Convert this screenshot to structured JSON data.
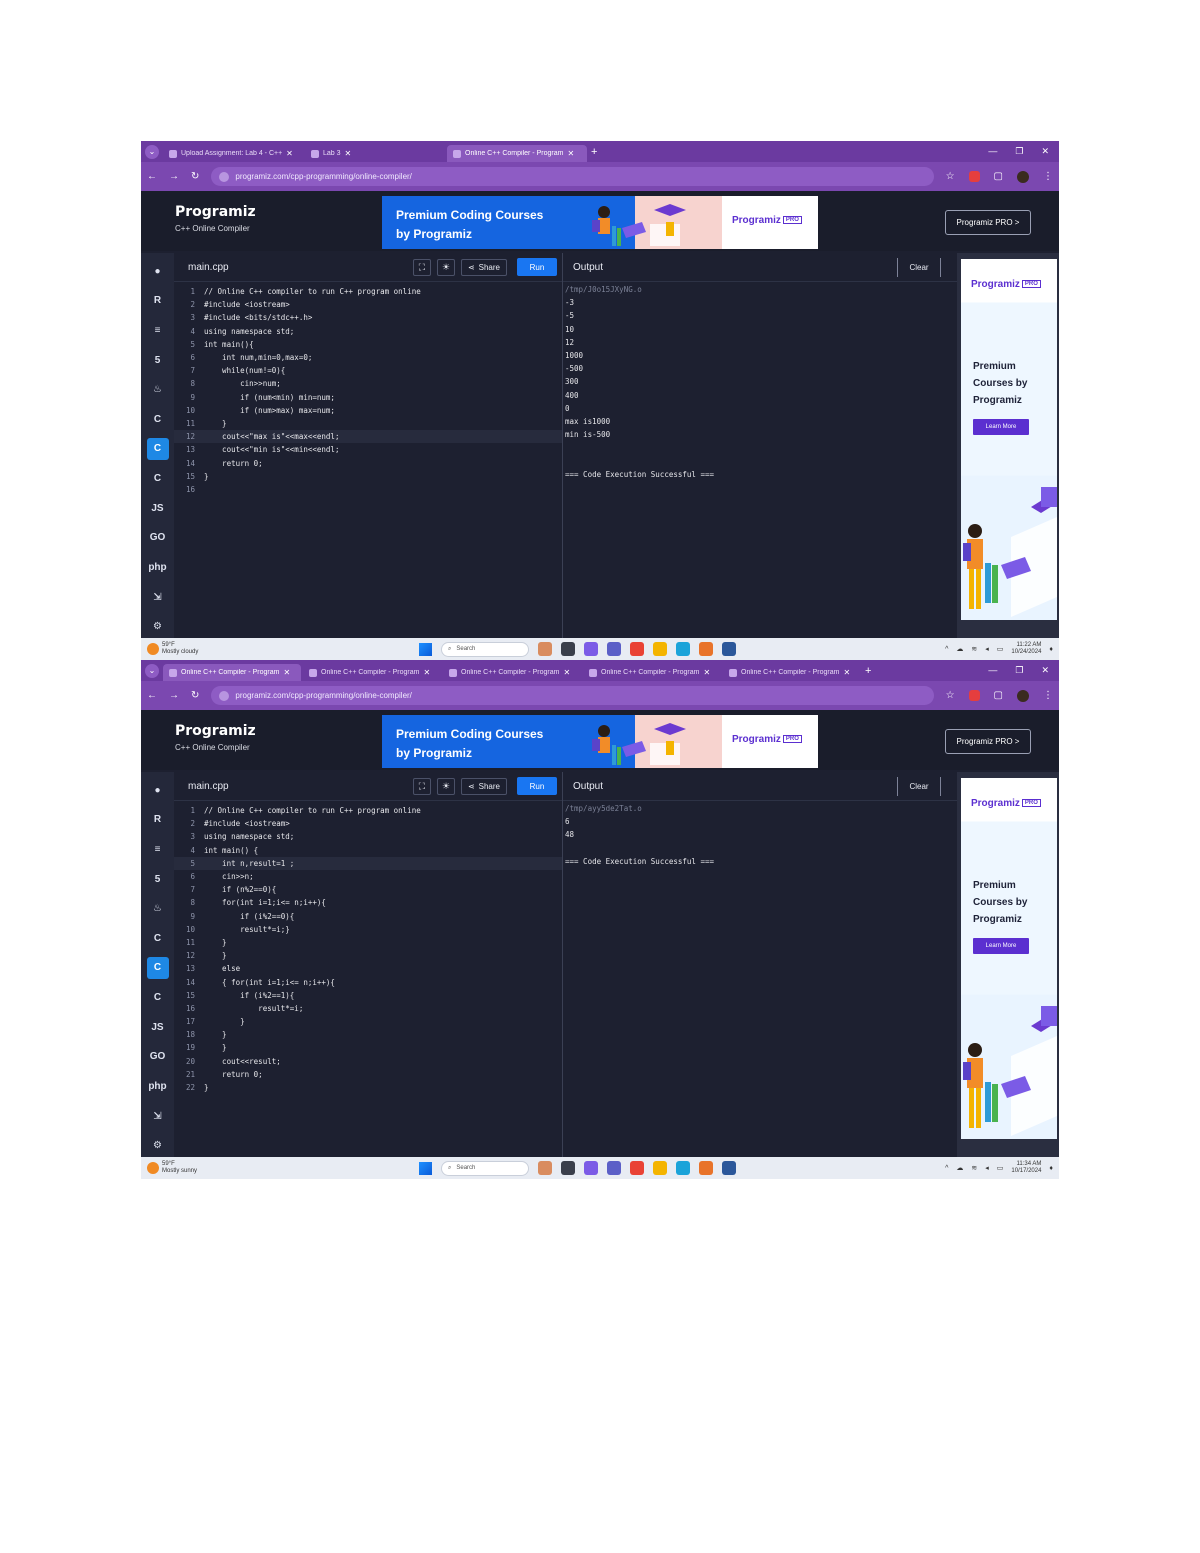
{
  "screens": [
    {
      "tabs": [
        {
          "title": "Upload Assignment: Lab 4 - C++",
          "active": false
        },
        {
          "title": "Lab 3",
          "active": false
        },
        {
          "title": "Online C++ Compiler - Program",
          "active": true
        }
      ],
      "url": "programiz.com/cpp-programming/online-compiler/",
      "header": {
        "logo": "Programiz",
        "subtitle": "C++ Online Compiler",
        "pro_button": "Programiz PRO >"
      },
      "banner": {
        "text": "Premium Coding Courses by Programiz",
        "logo": "Programiz",
        "tag": "PRO"
      },
      "editor": {
        "file_tab": "main.cpp",
        "share_label": "Share",
        "run_label": "Run",
        "highlight_line": 12,
        "lines": [
          "// Online C++ compiler to run C++ program online",
          "#include <iostream>",
          "#include <bits/stdc++.h>",
          "using namespace std;",
          "int main(){",
          "    int num,min=0,max=0;",
          "    while(num!=0){",
          "        cin>>num;",
          "        if (num<min) min=num;",
          "        if (num>max) max=num;",
          "    }",
          "    cout<<\"max is\"<<max<<endl;",
          "    cout<<\"min is\"<<min<<endl;",
          "    return 0;",
          "}",
          ""
        ]
      },
      "output": {
        "title": "Output",
        "clear_label": "Clear",
        "lines": [
          "/tmp/J0o15JXyNG.o",
          "-3",
          "-5",
          "10",
          "12",
          "1000",
          "-500",
          "300",
          "400",
          "0",
          "max is1000",
          "min is-500",
          "",
          "",
          "=== Code Execution Successful ==="
        ]
      },
      "ad": {
        "logo": "Programiz",
        "tag": "PRO",
        "text": "Premium Courses by Programiz",
        "button": "Learn More"
      },
      "taskbar": {
        "weather_temp": "59°F",
        "weather_text": "Mostly cloudy",
        "search": "Search",
        "time": "11:22 AM",
        "date": "10/24/2024"
      }
    },
    {
      "tabs": [
        {
          "title": "Online C++ Compiler - Program",
          "active": true
        },
        {
          "title": "Online C++ Compiler - Program",
          "active": false
        },
        {
          "title": "Online C++ Compiler - Program",
          "active": false
        },
        {
          "title": "Online C++ Compiler - Program",
          "active": false
        },
        {
          "title": "Online C++ Compiler - Program",
          "active": false
        }
      ],
      "url": "programiz.com/cpp-programming/online-compiler/",
      "header": {
        "logo": "Programiz",
        "subtitle": "C++ Online Compiler",
        "pro_button": "Programiz PRO >"
      },
      "banner": {
        "text": "Premium Coding Courses by Programiz",
        "logo": "Programiz",
        "tag": "PRO"
      },
      "editor": {
        "file_tab": "main.cpp",
        "share_label": "Share",
        "run_label": "Run",
        "highlight_line": 5,
        "lines": [
          "// Online C++ compiler to run C++ program online",
          "#include <iostream>",
          "using namespace std;",
          "int main() {",
          "    int n,result=1 ;",
          "    cin>>n;",
          "    if (n%2==0){",
          "    for(int i=1;i<= n;i++){",
          "        if (i%2==0){",
          "        result*=i;}",
          "    }",
          "    }",
          "    else",
          "    { for(int i=1;i<= n;i++){",
          "        if (i%2==1){",
          "            result*=i;",
          "        }",
          "    }",
          "    }",
          "    cout<<result;",
          "    return 0;",
          "}"
        ]
      },
      "output": {
        "title": "Output",
        "clear_label": "Clear",
        "lines": [
          "/tmp/ayy5de2Tat.o",
          "6",
          "48",
          "",
          "=== Code Execution Successful ==="
        ]
      },
      "ad": {
        "logo": "Programiz",
        "tag": "PRO",
        "text": "Premium Courses by Programiz",
        "button": "Learn More"
      },
      "taskbar": {
        "weather_temp": "59°F",
        "weather_text": "Mostly sunny",
        "search": "Search",
        "time": "11:34 AM",
        "date": "10/17/2024"
      }
    }
  ],
  "lang_icons": [
    "python-icon",
    "r-icon",
    "sql-icon",
    "html-icon",
    "java-icon",
    "c-icon",
    "cpp-icon",
    "csharp-icon",
    "js-icon",
    "go-icon",
    "php-icon",
    "swift-icon",
    "rust-icon"
  ],
  "lang_glyphs": [
    "●",
    "R",
    "≡",
    "5",
    "♨",
    "C",
    "C",
    "C",
    "JS",
    "GO",
    "php",
    "⇲",
    "⚙"
  ],
  "active_lang_index": 6
}
